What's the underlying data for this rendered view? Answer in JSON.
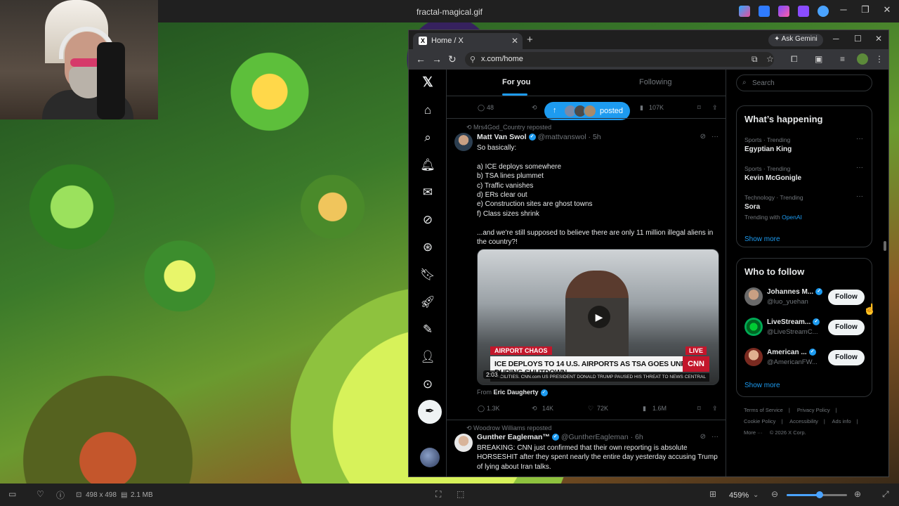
{
  "viewer": {
    "title": "fractal-magical.gif",
    "status": {
      "dimensions": "498 x 498",
      "filesize": "2.1 MB",
      "zoom": "459%",
      "zoom_level": 0.55
    }
  },
  "browser": {
    "tab_title": "Home / X",
    "tab_close": "✕",
    "new_tab": "+",
    "ask_gemini": "Ask Gemini",
    "url": "x.com/home"
  },
  "timeline": {
    "tabs": [
      "For you",
      "Following"
    ],
    "posted_pill": "posted",
    "prev_actions": {
      "replies": "48",
      "likes": "107K"
    },
    "tweet1": {
      "repost_by": "Mrs4God_Country reposted",
      "name": "Matt Van Swol",
      "handle": "@mattvanswol · 5h",
      "text_lines": [
        "So basically:",
        "",
        "a) ICE deploys somewhere",
        "b) TSA lines plummet",
        "c) Traffic vanishes",
        "d) ERs clear out",
        "e) Construction sites are ghost towns",
        "f) Class sizes shrink",
        "",
        "...and we're still supposed to believe there are only 11 million illegal aliens in the country?!"
      ],
      "video": {
        "tag": "AIRPORT CHAOS",
        "live": "LIVE",
        "headline": "ICE DEPLOYS TO 14 U.S. AIRPORTS AS TSA GOES UNPAID DURING SHUTDOWN",
        "network": "CNN",
        "ticker": "...ACILITIES.   CNN.com   US PRESIDENT DONALD TRUMP PAUSED HIS THREAT TO NEWS CENTRAL",
        "duration": "2:03"
      },
      "from_prefix": "From",
      "from_name": "Eric Daugherty",
      "actions": {
        "replies": "1.3K",
        "reposts": "14K",
        "likes": "72K",
        "views": "1.6M"
      }
    },
    "tweet2": {
      "repost_by": "Woodrow Williams reposted",
      "name": "Gunther Eagleman™",
      "handle": "@GuntherEagleman · 6h",
      "text": "BREAKING: CNN just confirmed that their own reporting is absolute HORSESHIT after they spent nearly the entire day yesterday accusing Trump of lying about Iran talks."
    }
  },
  "sidebar": {
    "search_placeholder": "Search",
    "happening_title": "What’s happening",
    "trends": [
      {
        "category": "Sports · Trending",
        "name": "Egyptian King"
      },
      {
        "category": "Sports · Trending",
        "name": "Kevin McGonigle"
      },
      {
        "category": "Technology · Trending",
        "name": "Sora",
        "with_prefix": "Trending with",
        "with": "OpenAI"
      }
    ],
    "show_more": "Show more",
    "follow_title": "Who to follow",
    "follow": [
      {
        "name": "Johannes M...",
        "handle": "@luo_yuehan",
        "button": "Follow"
      },
      {
        "name": "LiveStream...",
        "handle": "@LiveStreamC...",
        "button": "Follow"
      },
      {
        "name": "American ...",
        "handle": "@AmericanFW...",
        "button": "Follow"
      }
    ],
    "footer": [
      "Terms of Service",
      "|",
      "Privacy Policy",
      "|",
      "Cookie Policy",
      "|",
      "Accessibility",
      "|",
      "Ads info",
      "|",
      "More ···",
      "© 2026 X Corp."
    ]
  },
  "colors": {
    "accent": "#1d9bf0",
    "live_red": "#c3162b"
  }
}
